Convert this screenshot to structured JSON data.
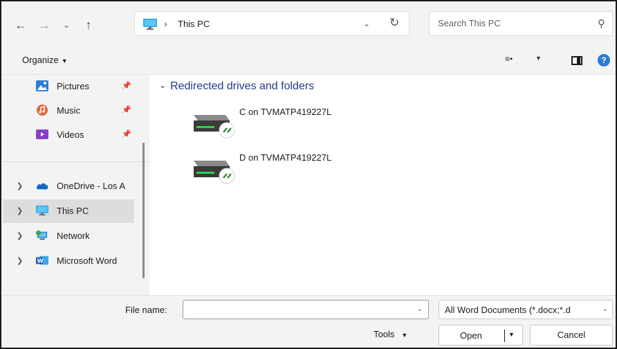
{
  "address_bar": {
    "path": "This PC"
  },
  "search": {
    "placeholder": "Search This PC"
  },
  "toolbar": {
    "organize_label": "Organize"
  },
  "nav_pane": {
    "items": [
      {
        "label": "Pictures",
        "icon": "pictures-icon",
        "pinned": true
      },
      {
        "label": "Music",
        "icon": "music-icon",
        "pinned": true
      },
      {
        "label": "Videos",
        "icon": "videos-icon",
        "pinned": true
      },
      {
        "label": "OneDrive - Los A",
        "icon": "onedrive-icon",
        "expandable": true
      },
      {
        "label": "This PC",
        "icon": "this-pc-icon",
        "expandable": true,
        "selected": true
      },
      {
        "label": "Network",
        "icon": "network-icon",
        "expandable": true
      },
      {
        "label": "Microsoft Word",
        "icon": "word-icon",
        "expandable": true
      }
    ]
  },
  "content": {
    "group_header": "Redirected drives and folders",
    "drives": [
      {
        "label": "C on TVMATP419227L",
        "icon": "redirected-drive-icon"
      },
      {
        "label": "D on TVMATP419227L",
        "icon": "redirected-drive-icon"
      }
    ]
  },
  "footer": {
    "file_name_label": "File name:",
    "file_name_value": "",
    "file_type": "All Word Documents (*.docx;*.d",
    "tools_label": "Tools",
    "open_label": "Open",
    "cancel_label": "Cancel"
  },
  "colors": {
    "accent_header": "#1e3a8a",
    "help_blue": "#2a7bd9",
    "selected_bg": "#dddddd",
    "pane_bg": "#f3f3f3"
  }
}
